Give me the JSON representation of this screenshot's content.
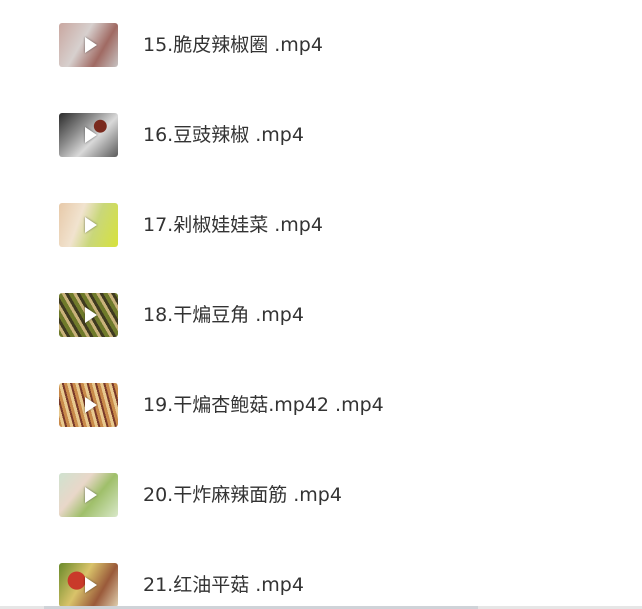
{
  "files": [
    {
      "name": "15.脆皮辣椒圈 .mp4",
      "thumb_icon": "video-thumbnail"
    },
    {
      "name": "16.豆豉辣椒 .mp4",
      "thumb_icon": "video-thumbnail"
    },
    {
      "name": "17.剁椒娃娃菜 .mp4",
      "thumb_icon": "video-thumbnail"
    },
    {
      "name": "18.干煸豆角 .mp4",
      "thumb_icon": "video-thumbnail"
    },
    {
      "name": "19.干煸杏鲍菇.mp42 .mp4",
      "thumb_icon": "video-thumbnail"
    },
    {
      "name": "20.干炸麻辣面筋 .mp4",
      "thumb_icon": "video-thumbnail"
    },
    {
      "name": "21.红油平菇 .mp4",
      "thumb_icon": "video-thumbnail"
    }
  ],
  "colors": {
    "text": "#333333",
    "background": "#ffffff",
    "play_icon": "#ffffff"
  }
}
